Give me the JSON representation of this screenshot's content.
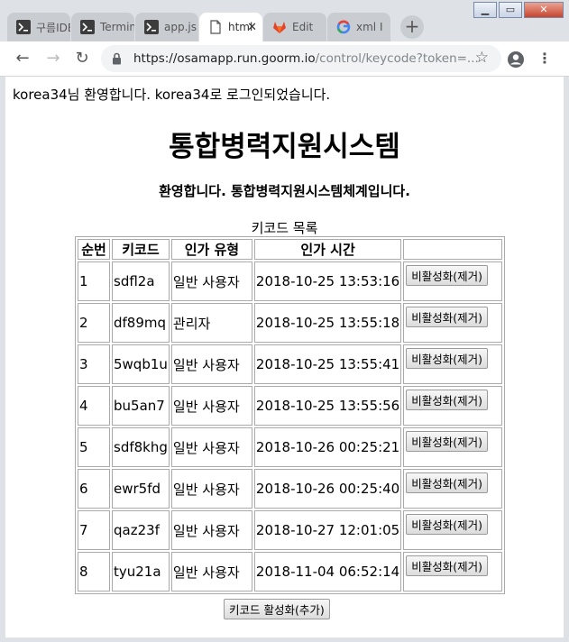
{
  "browser": {
    "tabs": [
      {
        "label": "구름IDE",
        "icon": "terminal-icon"
      },
      {
        "label": "Terminal",
        "icon": "terminal-icon"
      },
      {
        "label": "app.js",
        "icon": "terminal-icon"
      },
      {
        "label": "html",
        "icon": "page-icon",
        "active": true
      },
      {
        "label": "Edit",
        "icon": "gitlab-icon"
      },
      {
        "label": "xml I",
        "icon": "google-icon"
      }
    ],
    "url_host": "https://osamapp.run.goorm.io",
    "url_path": "/control/keycode?token=..."
  },
  "page": {
    "welcome": "korea34님 환영합니다. korea34로 로그인되었습니다.",
    "title": "통합병력지원시스템",
    "subtitle": "환영합니다. 통합병력지원시스템체계입니다.",
    "table_caption": "키코드 목록",
    "headers": [
      "순번",
      "키코드",
      "인가 유형",
      "인가 시간",
      ""
    ],
    "rows": [
      {
        "no": "1",
        "code": "sdfl2a",
        "type": "일반 사용자",
        "time": "2018-10-25 13:53:16"
      },
      {
        "no": "2",
        "code": "df89mq",
        "type": "관리자",
        "time": "2018-10-25 13:55:18"
      },
      {
        "no": "3",
        "code": "5wqb1u",
        "type": "일반 사용자",
        "time": "2018-10-25 13:55:41"
      },
      {
        "no": "4",
        "code": "bu5an7",
        "type": "일반 사용자",
        "time": "2018-10-25 13:55:56"
      },
      {
        "no": "5",
        "code": "sdf8khg",
        "type": "일반 사용자",
        "time": "2018-10-26 00:25:21"
      },
      {
        "no": "6",
        "code": "ewr5fd",
        "type": "일반 사용자",
        "time": "2018-10-26 00:25:40"
      },
      {
        "no": "7",
        "code": "qaz23f",
        "type": "일반 사용자",
        "time": "2018-10-27 12:01:05"
      },
      {
        "no": "8",
        "code": "tyu21a",
        "type": "일반 사용자",
        "time": "2018-11-04 06:52:14"
      }
    ],
    "remove_label": "비활성화(제거)",
    "add_label": "키코드 활성화(추가)"
  }
}
